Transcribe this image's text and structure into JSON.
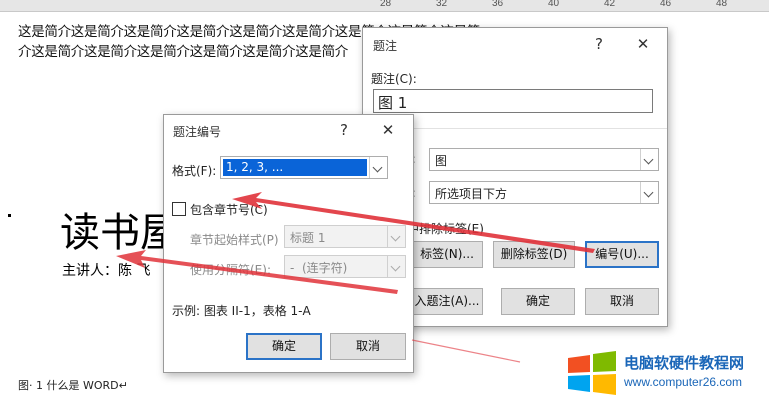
{
  "ruler": {
    "numbers": [
      "28",
      "",
      "32",
      "",
      "36",
      "",
      "40",
      "",
      "42",
      "",
      "46",
      "",
      "48"
    ]
  },
  "document": {
    "line1": "这是简介这是简介这是简介这是简介这是简介这是简介这是简介这是简介这是简",
    "line2": "介这是简介这是简介这是简介这是简介这是简介这是简介",
    "title": "读书屋",
    "speaker": "主讲人：陈 飞",
    "caption": "图· 1 什么是 WORD↵"
  },
  "caption_dialog": {
    "title": "题注",
    "help": "?",
    "close": "✕",
    "caption_label": "题注(C):",
    "caption_value": "图 1",
    "label_label": "):",
    "label_value": "图",
    "position_label": "):",
    "position_value": "所选项目下方",
    "exclude_label": "中排除标签(E)",
    "new_label_button": "标签(N)...",
    "delete_label_button": "删除标签(D)",
    "numbering_button": "编号(U)...",
    "autocaption_button": "入题注(A)...",
    "ok_button": "确定",
    "cancel_button": "取消"
  },
  "numbering_dialog": {
    "title": "题注编号",
    "help": "?",
    "close": "✕",
    "format_label": "格式(F):",
    "format_value": "1, 2, 3, ...",
    "include_chapter_label": "包含章节号(C)",
    "chapter_style_label": "章节起始样式(P)",
    "chapter_style_value": "标题 1",
    "separator_label": "使用分隔符(E):",
    "separator_value": "-  (连字符)",
    "example": "示例: 图表 II-1，表格 1-A",
    "ok_button": "确定",
    "cancel_button": "取消"
  },
  "watermark": {
    "site_name": "电脑软硬件教程网",
    "url": "www.computer26.com"
  },
  "colors": {
    "arrow": "#e0323a",
    "accent": "#2b73c7",
    "highlight": "#0a64d8"
  }
}
